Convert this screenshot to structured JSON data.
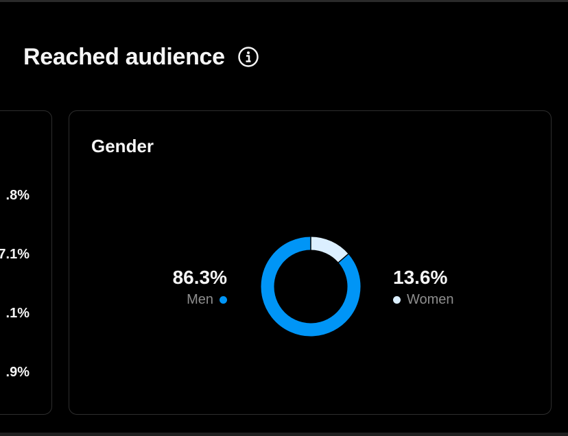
{
  "header": {
    "title": "Reached audience",
    "info_icon": "info-icon"
  },
  "left_card": {
    "percentages": [
      ".8%",
      "7.1%",
      ".1%",
      ".9%"
    ]
  },
  "gender_card": {
    "title": "Gender",
    "men": {
      "value": "86.3%",
      "label": "Men",
      "color": "#0095f6"
    },
    "women": {
      "value": "13.6%",
      "label": "Women",
      "color": "#dbefff"
    }
  },
  "chart_data": {
    "type": "pie",
    "title": "Gender",
    "categories": [
      "Men",
      "Women"
    ],
    "values": [
      86.3,
      13.6
    ],
    "colors": [
      "#0095f6",
      "#dbefff"
    ],
    "donut": true
  }
}
